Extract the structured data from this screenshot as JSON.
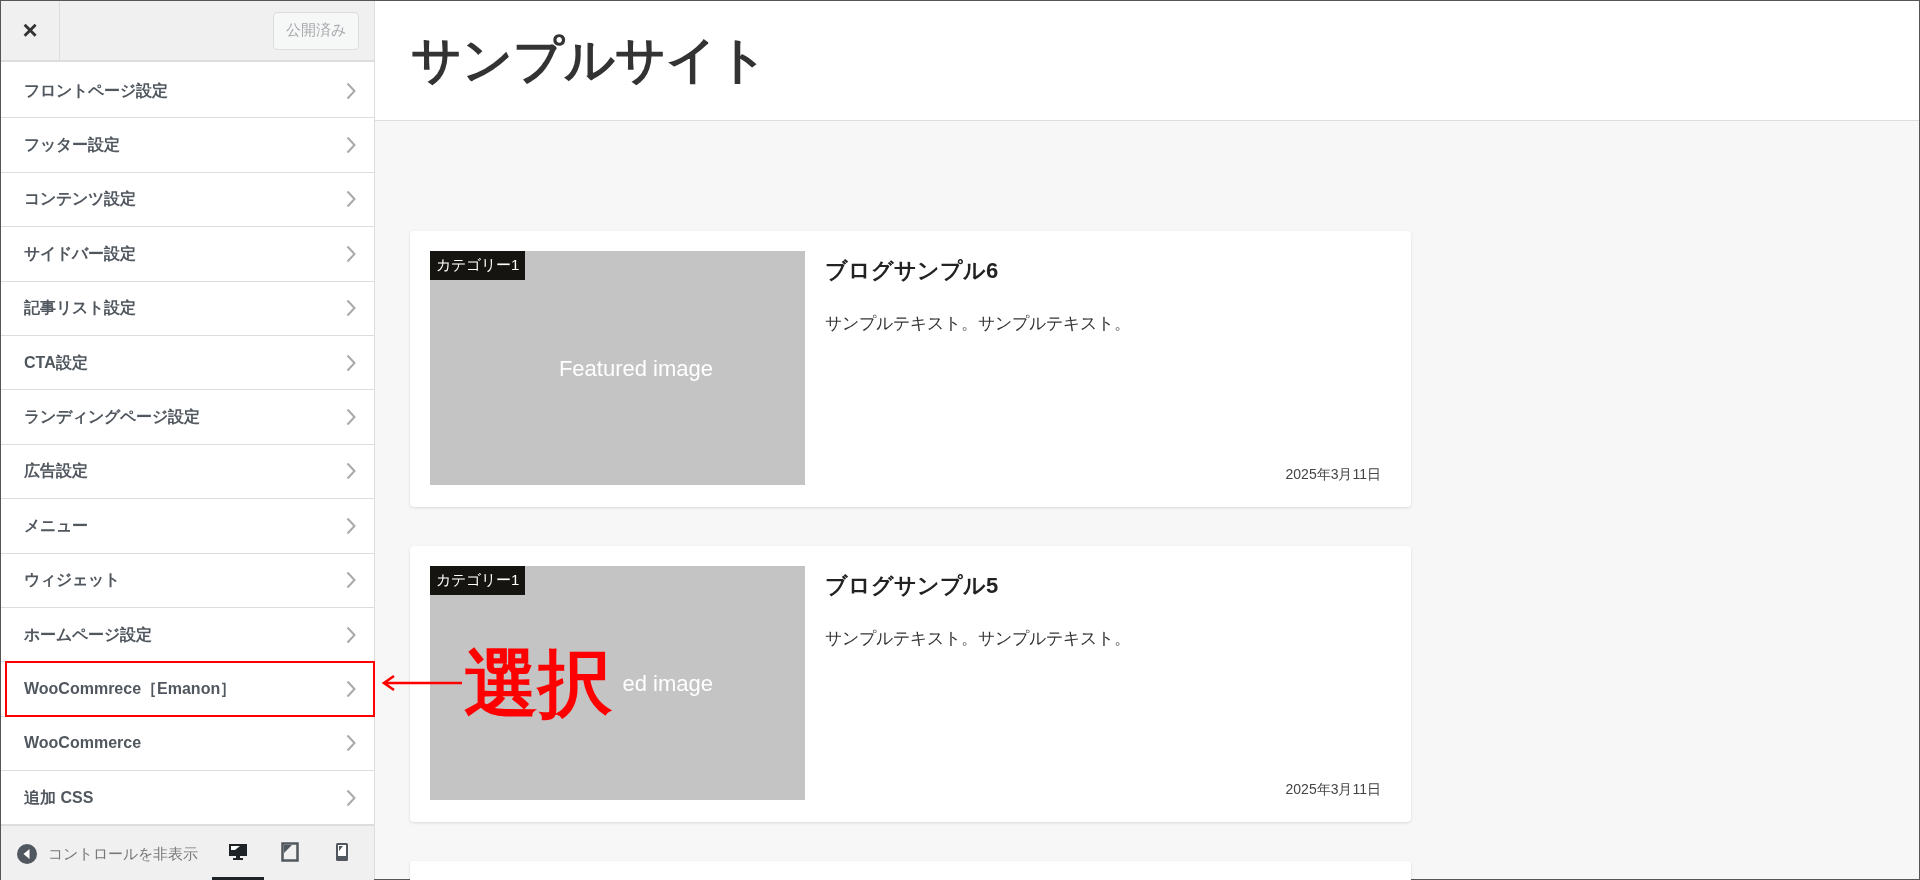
{
  "sidebar": {
    "close": "×",
    "publish_button": {
      "label": "公開済み",
      "disabled": true
    },
    "items": [
      {
        "label": "フロントページ設定",
        "highlighted": false
      },
      {
        "label": "フッター設定",
        "highlighted": false
      },
      {
        "label": "コンテンツ設定",
        "highlighted": false
      },
      {
        "label": "サイドバー設定",
        "highlighted": false
      },
      {
        "label": "記事リスト設定",
        "highlighted": false
      },
      {
        "label": "CTA設定",
        "highlighted": false
      },
      {
        "label": "ランディングページ設定",
        "highlighted": false
      },
      {
        "label": "広告設定",
        "highlighted": false
      },
      {
        "label": "メニュー",
        "highlighted": false
      },
      {
        "label": "ウィジェット",
        "highlighted": false
      },
      {
        "label": "ホームページ設定",
        "highlighted": false
      },
      {
        "label": "WooCommrece［Emanon］",
        "highlighted": true
      },
      {
        "label": "WooCommerce",
        "highlighted": false
      },
      {
        "label": "追加 CSS",
        "highlighted": false
      }
    ],
    "footer": {
      "hide_controls": "コントロールを非表示",
      "devices": [
        {
          "kind": "desktop",
          "selected": true
        },
        {
          "kind": "tablet",
          "selected": false
        },
        {
          "kind": "mobile",
          "selected": false
        }
      ]
    }
  },
  "preview": {
    "site_title": "サンプルサイト",
    "posts": [
      {
        "category": "カテゴリー1",
        "image_label": "Featured image",
        "title": "ブログサンプル6",
        "excerpt": "サンプルテキスト。サンプルテキスト。",
        "date": "2025年3月11日"
      },
      {
        "category": "カテゴリー1",
        "image_label": "ed image",
        "title": "ブログサンプル5",
        "excerpt": "サンプルテキスト。サンプルテキスト。",
        "date": "2025年3月11日"
      }
    ]
  },
  "annotation": {
    "label": "選択"
  }
}
